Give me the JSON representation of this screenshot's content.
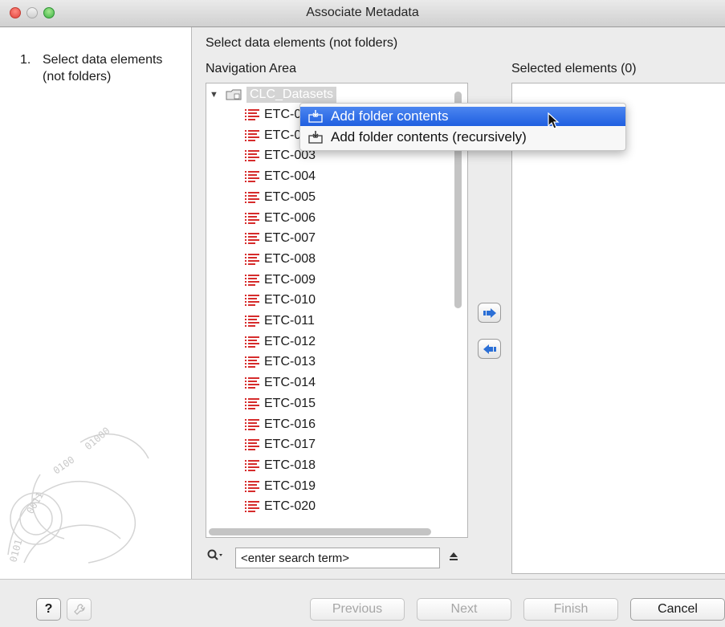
{
  "window": {
    "title": "Associate Metadata"
  },
  "sidebar": {
    "steps": [
      {
        "number": "1.",
        "label": "Select data elements (not folders)"
      }
    ]
  },
  "main": {
    "heading": "Select data elements (not folders)",
    "navigation_label": "Navigation Area",
    "selected_label": "Selected elements (0)",
    "tree": {
      "folder": {
        "label": "CLC_Datasets",
        "expanded": true,
        "icon": "folder-icon"
      },
      "items": [
        "ETC-0",
        "ETC-0",
        "ETC-003",
        "ETC-004",
        "ETC-005",
        "ETC-006",
        "ETC-007",
        "ETC-008",
        "ETC-009",
        "ETC-010",
        "ETC-011",
        "ETC-012",
        "ETC-013",
        "ETC-014",
        "ETC-015",
        "ETC-016",
        "ETC-017",
        "ETC-018",
        "ETC-019",
        "ETC-020"
      ],
      "item_icon": "sequence-list-icon"
    },
    "search": {
      "placeholder": "<enter search term>",
      "icon": "search-icon"
    },
    "add_arrow_icon": "arrow-right-icon",
    "remove_arrow_icon": "arrow-left-icon"
  },
  "context_menu": {
    "items": [
      {
        "label": "Add folder contents",
        "icon": "add-folder-icon",
        "highlighted": true
      },
      {
        "label": "Add folder contents (recursively)",
        "icon": "add-folder-icon",
        "highlighted": false
      }
    ]
  },
  "footer": {
    "help_label": "?",
    "buttons": {
      "previous": "Previous",
      "next": "Next",
      "finish": "Finish",
      "cancel": "Cancel"
    }
  },
  "colors": {
    "accent": "#2f6fe6",
    "sequence_icon": "#d62c2c",
    "window_bg": "#ececec"
  }
}
